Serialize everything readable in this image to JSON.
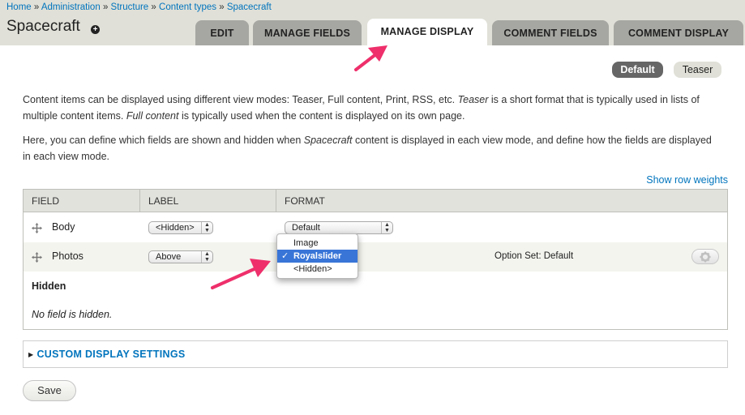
{
  "breadcrumb": {
    "items": [
      "Home",
      "Administration",
      "Structure",
      "Content types",
      "Spacecraft"
    ],
    "separator": "»"
  },
  "page": {
    "title": "Spacecraft",
    "shortcut_symbol": "+"
  },
  "tabs": [
    {
      "label": "EDIT",
      "active": false
    },
    {
      "label": "MANAGE FIELDS",
      "active": false
    },
    {
      "label": "MANAGE DISPLAY",
      "active": true
    },
    {
      "label": "COMMENT FIELDS",
      "active": false
    },
    {
      "label": "COMMENT DISPLAY",
      "active": false
    }
  ],
  "view_modes": {
    "default": "Default",
    "teaser": "Teaser"
  },
  "help": {
    "p1_a": "Content items can be displayed using different view modes: Teaser, Full content, Print, RSS, etc. ",
    "p1_em1": "Teaser",
    "p1_b": " is a short format that is typically used in lists of multiple content items. ",
    "p1_em2": "Full content",
    "p1_c": " is typically used when the content is displayed on its own page.",
    "p2_a": "Here, you can define which fields are shown and hidden when ",
    "p2_em": "Spacecraft",
    "p2_b": " content is displayed in each view mode, and define how the fields are displayed in each view mode."
  },
  "show_row_weights": "Show row weights",
  "table": {
    "headers": {
      "field": "FIELD",
      "label": "LABEL",
      "format": "FORMAT"
    },
    "rows": [
      {
        "field": "Body",
        "label": "<Hidden>",
        "format": "Default",
        "summary": ""
      },
      {
        "field": "Photos",
        "label": "Above",
        "format": "Royalslider",
        "summary": "Option Set: Default"
      }
    ],
    "hidden_region": {
      "title": "Hidden",
      "empty_text": "No field is hidden."
    }
  },
  "format_dropdown": {
    "options": [
      "Image",
      "Royalslider",
      "<Hidden>"
    ],
    "selected": "Royalslider",
    "check": "✓"
  },
  "custom_display_settings": "CUSTOM DISPLAY SETTINGS",
  "save_label": "Save",
  "colors": {
    "link": "#0074bd",
    "tab_inactive": "#a6a7a2",
    "header_bg": "#e0e0d8",
    "dropdown_selected": "#3875d7",
    "annotation_arrow": "#ee2f6b"
  }
}
